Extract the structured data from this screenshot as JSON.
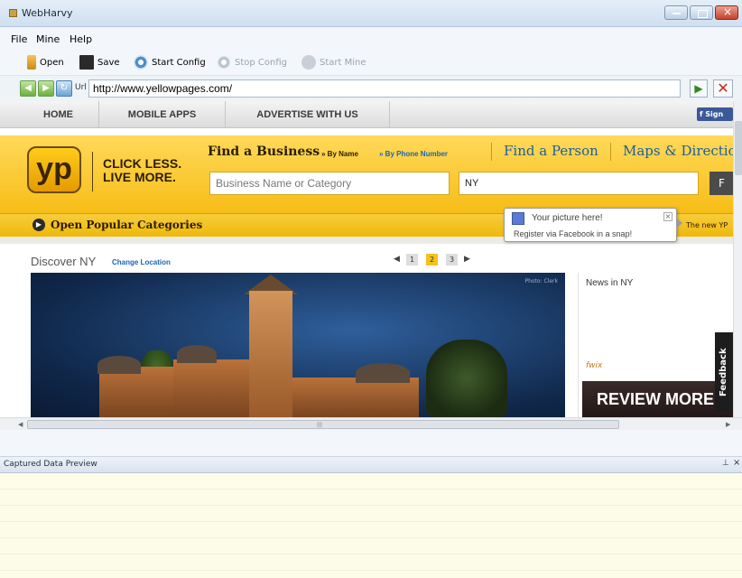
{
  "window": {
    "title": "WebHarvy"
  },
  "menu": {
    "items": [
      "File",
      "Mine",
      "Help"
    ]
  },
  "toolbar": {
    "open": "Open",
    "save": "Save",
    "start_config": "Start Config",
    "stop_config": "Stop Config",
    "start_mine": "Start Mine"
  },
  "address": {
    "label": "Url",
    "url": "http://www.yellowpages.com/"
  },
  "site": {
    "nav": [
      "HOME",
      "MOBILE APPS",
      "ADVERTISE WITH US"
    ],
    "fb_button": "Sign",
    "logo": "yp",
    "slogan_line1": "CLICK LESS.",
    "slogan_line2": "LIVE MORE.",
    "find_business": "Find a Business",
    "by_name": "» By Name",
    "by_phone": "» By Phone Number",
    "find_person": "Find a Person",
    "maps_directions": "Maps & Directio",
    "business_placeholder": "Business Name or Category",
    "location_value": "NY",
    "find_button": "F",
    "open_categories": "Open Popular Categories",
    "new_label": "The new YP",
    "discover": "Discover NY",
    "change_location": "Change Location",
    "pager": [
      "1",
      "2",
      "3"
    ],
    "pager_active": "2",
    "photo_credit": "Photo: Clerk",
    "news_title": "News in NY",
    "news_source": "fwix",
    "review_banner": "REVIEW MORE",
    "feedback": "Feedback"
  },
  "popup": {
    "heading": "Your picture here!",
    "body": "Register via Facebook in a snap!"
  },
  "panel": {
    "title": "Captured Data Preview"
  }
}
